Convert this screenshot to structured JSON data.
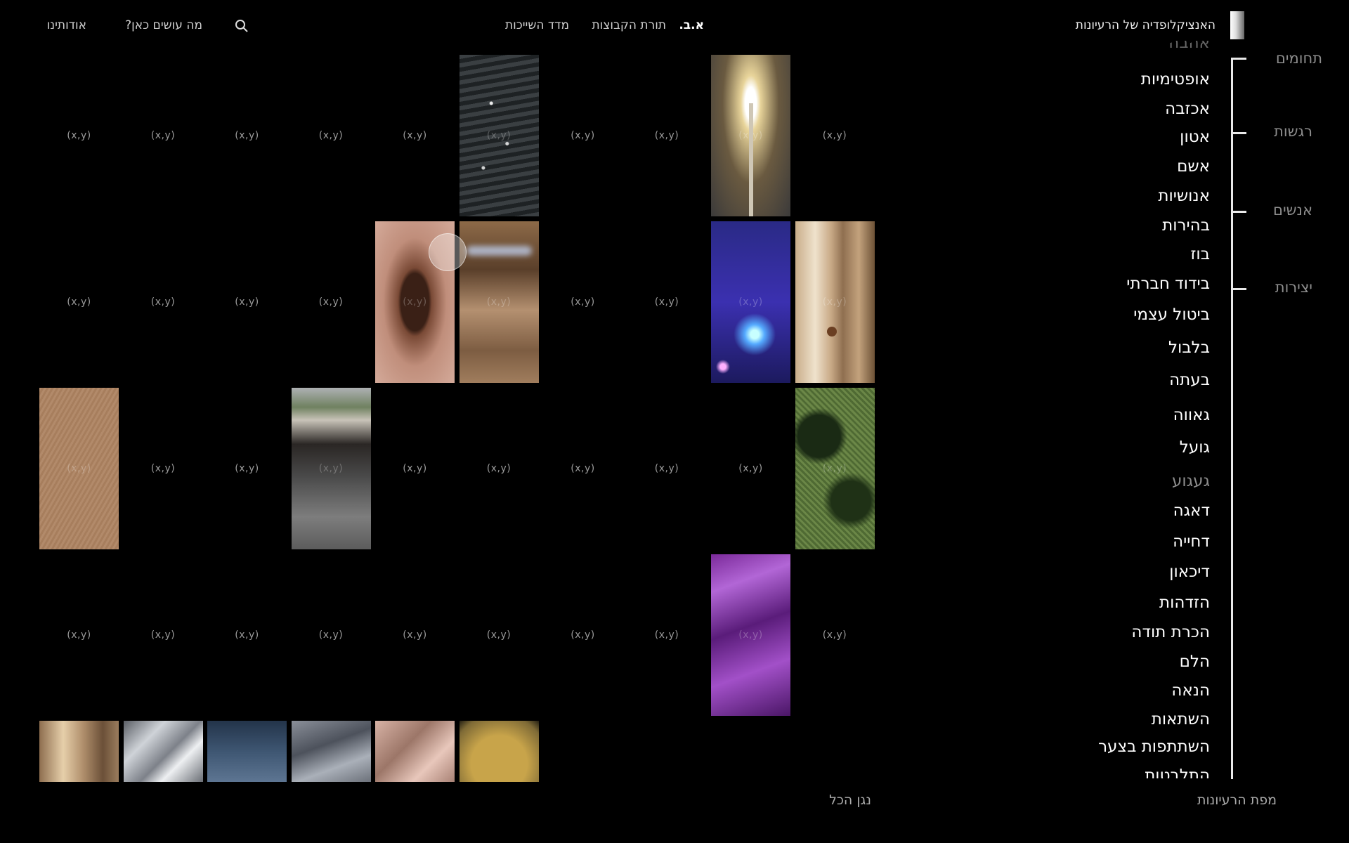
{
  "header": {
    "site_title": "האנציקלופדיה של הרעיונות",
    "nav": [
      "א.ב.",
      "תורת הקבוצות",
      "מדד השייכות"
    ],
    "what_here": "מה עושים כאן?",
    "about": "אודותינו"
  },
  "grid": {
    "cell_label": "(x,y)",
    "rows": [
      [
        "(x,y)",
        "(x,y)",
        "(x,y)",
        "(x,y)",
        "(x,y)",
        "water-sparkle",
        "(x,y)",
        "(x,y)",
        "street-lamp",
        "(x,y)"
      ],
      [
        "(x,y)",
        "(x,y)",
        "(x,y)",
        "(x,y)",
        "eye",
        "light-bars",
        "(x,y)",
        "(x,y)",
        "night-lights",
        "door"
      ],
      [
        "skin",
        "(x,y)",
        "(x,y)",
        "window",
        "(x,y)",
        "(x,y)",
        "(x,y)",
        "(x,y)",
        "(x,y)",
        "grass-shadow"
      ],
      [
        "(x,y)",
        "(x,y)",
        "(x,y)",
        "(x,y)",
        "(x,y)",
        "(x,y)",
        "(x,y)",
        "(x,y)",
        "purple-fabric",
        "(x,y)"
      ]
    ],
    "bottom_row": [
      "wood-light",
      "white-fabric",
      "blue-sky",
      "grey-cloud",
      "pink-fabric",
      "golden-cup"
    ]
  },
  "concepts": {
    "partial_top": "אהבה",
    "items": [
      "אופטימיות",
      "אכזבה",
      "אטון",
      "אשם",
      "אנושיות",
      "בהירות",
      "בוז",
      "בידוד חברתי",
      "ביטול עצמי",
      "בלבול",
      "בעתה",
      "גאווה",
      "גועל",
      "געגוע",
      "דאגה",
      "דחייה",
      "דיכאון",
      "הזדהות",
      "הכרת תודה",
      "הלם",
      "הנאה",
      "השתאות",
      "השתתפות בצער",
      "התלבטות"
    ],
    "dimmed": "געגוע"
  },
  "categories": [
    "תחומים",
    "רגשות",
    "אנשים",
    "יצירות"
  ],
  "footer": {
    "play_all": "נגן הכל",
    "ideas_map": "מפת הרעיונות"
  },
  "colors": {
    "background": "#000000",
    "text": "#ffffff",
    "muted": "#8d8d8d"
  }
}
